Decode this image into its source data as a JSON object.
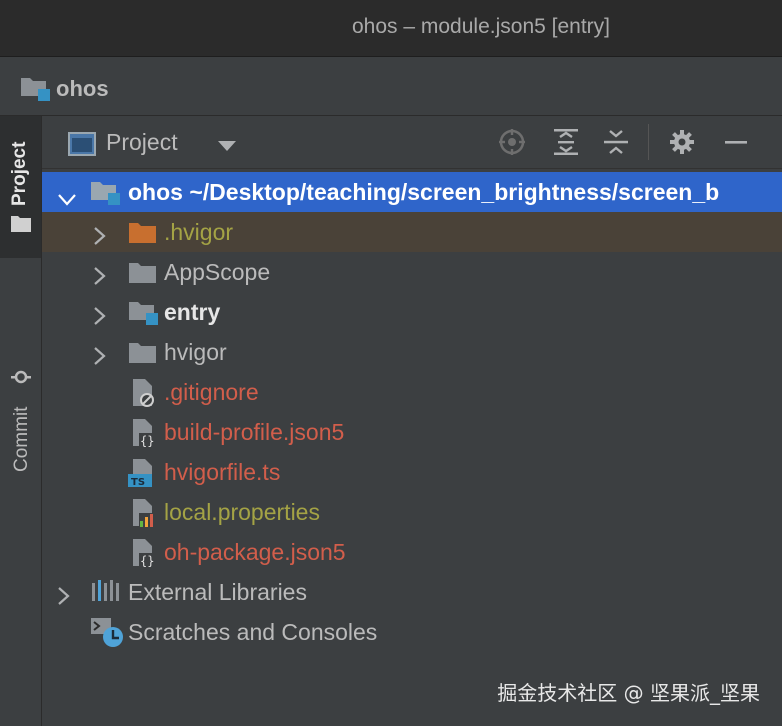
{
  "window": {
    "title": "ohos – module.json5 [entry]"
  },
  "navbar": {
    "project_name": "ohos"
  },
  "tool_stripe": {
    "project_tab": "Project",
    "commit_tab": "Commit"
  },
  "panel": {
    "view_label": "Project"
  },
  "tree": {
    "root": {
      "name": "ohos",
      "path": "~/Desktop/teaching/screen_brightness/screen_b"
    },
    "items": [
      {
        "label": ".hvigor",
        "color": "#a4a345"
      },
      {
        "label": "AppScope",
        "color": "#bbbbbb"
      },
      {
        "label": "entry",
        "color": "#e6e6e6"
      },
      {
        "label": "hvigor",
        "color": "#bbbbbb"
      },
      {
        "label": ".gitignore",
        "color": "#d25e4b"
      },
      {
        "label": "build-profile.json5",
        "color": "#d25e4b"
      },
      {
        "label": "hvigorfile.ts",
        "color": "#d25e4b"
      },
      {
        "label": "local.properties",
        "color": "#a4a345"
      },
      {
        "label": "oh-package.json5",
        "color": "#d25e4b"
      }
    ],
    "external_libraries": "External Libraries",
    "scratches": "Scratches and Consoles"
  },
  "watermark": "掘金技术社区 @ 坚果派_坚果",
  "colors": {
    "selection": "#2f65ca",
    "ignored_row": "#4a4238",
    "module_badge": "#3592c4"
  }
}
